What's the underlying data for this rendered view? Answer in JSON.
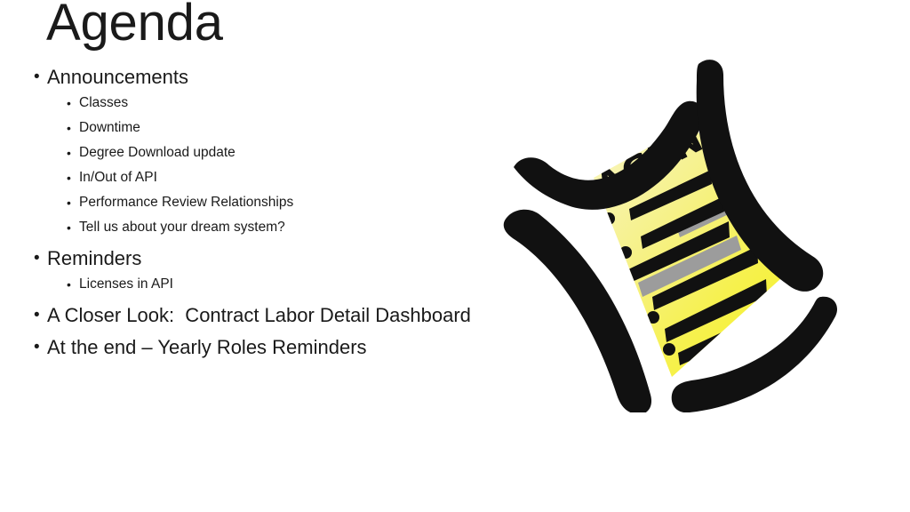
{
  "slide": {
    "title": "Agenda",
    "background_color": "#ffffff",
    "text_color": "#1a1a1a"
  },
  "outline": [
    {
      "level": 1,
      "text": "Announcements"
    },
    {
      "level": 2,
      "text": "Classes"
    },
    {
      "level": 2,
      "text": "Downtime"
    },
    {
      "level": 2,
      "text": "Degree Download update"
    },
    {
      "level": 2,
      "text": "In/Out of API"
    },
    {
      "level": 2,
      "text": "Performance Review Relationships"
    },
    {
      "level": 2,
      "text": "Tell us about your dream system?"
    },
    {
      "level": 1,
      "text": "Reminders"
    },
    {
      "level": 2,
      "text": "Licenses in API"
    },
    {
      "level": 1,
      "text": "A Closer Look:  Contract Labor Detail Dashboard"
    },
    {
      "level": 1,
      "text": "At the end – Yearly Roles Reminders"
    }
  ],
  "bullet_glyph": "•",
  "clipart": {
    "name": "agenda-sheet-clipart",
    "caption": "AGENDA",
    "colors": {
      "paper_light": "#f6f29a",
      "paper_mid": "#f4ef6e",
      "paper_bright": "#f7f22e",
      "stroke": "#111111",
      "highlight_gray": "#9c9c9c",
      "paper_edge": "#ffffff"
    },
    "text_line_count": 6,
    "highlight_bar_count": 2,
    "dot_bullet_count": 4
  }
}
